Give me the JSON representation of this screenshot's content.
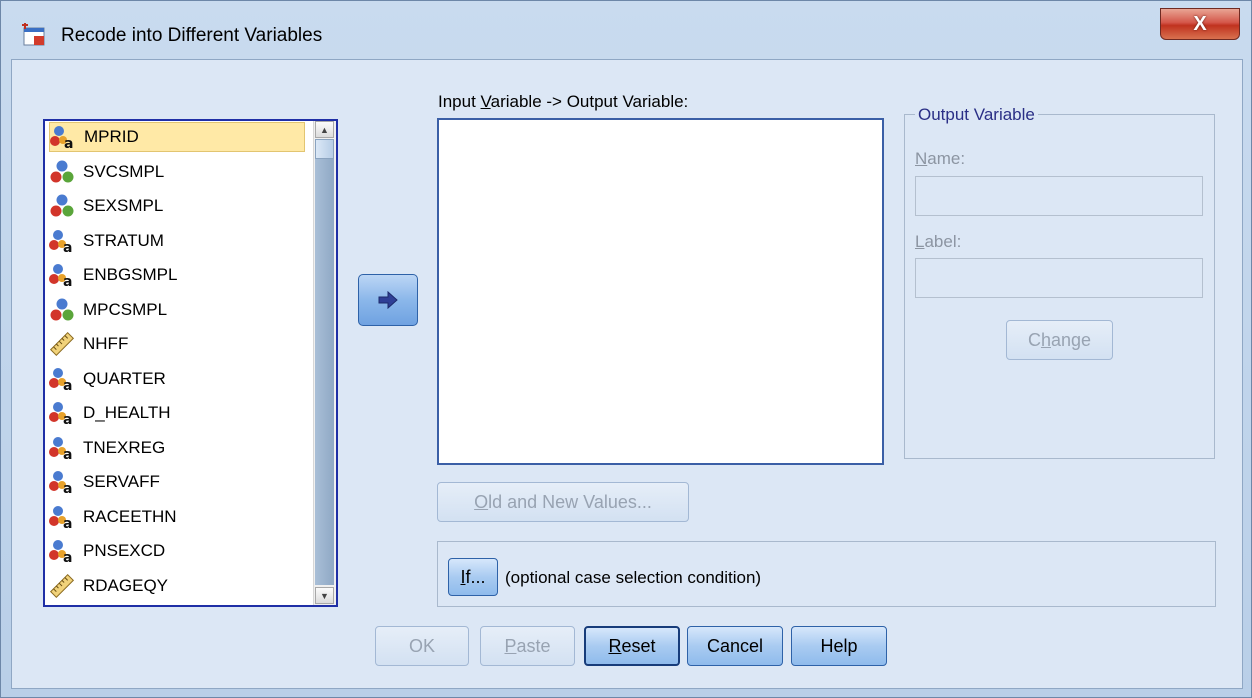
{
  "window": {
    "title": "Recode into Different Variables",
    "close_label": "X"
  },
  "variables": [
    {
      "name": "MPRID",
      "type": "nominal-string",
      "selected": true
    },
    {
      "name": "SVCSMPL",
      "type": "nominal"
    },
    {
      "name": "SEXSMPL",
      "type": "nominal"
    },
    {
      "name": "STRATUM",
      "type": "nominal-string"
    },
    {
      "name": "ENBGSMPL",
      "type": "nominal-string"
    },
    {
      "name": "MPCSMPL",
      "type": "nominal"
    },
    {
      "name": "NHFF",
      "type": "scale"
    },
    {
      "name": "QUARTER",
      "type": "nominal-string"
    },
    {
      "name": "D_HEALTH",
      "type": "nominal-string"
    },
    {
      "name": "TNEXREG",
      "type": "nominal-string"
    },
    {
      "name": "SERVAFF",
      "type": "nominal-string"
    },
    {
      "name": "RACEETHN",
      "type": "nominal-string"
    },
    {
      "name": "PNSEXCD",
      "type": "nominal-string"
    },
    {
      "name": "RDAGEQY",
      "type": "scale"
    }
  ],
  "mapping": {
    "label_pre": "Input ",
    "label_underlined": "V",
    "label_post": "ariable -> Output Variable:"
  },
  "output_variable": {
    "group_title": "Output Variable",
    "name_label_u": "N",
    "name_label_rest": "ame:",
    "name_value": "",
    "label_label_u": "L",
    "label_label_rest": "abel:",
    "label_value": "",
    "change_pre": "C",
    "change_u": "h",
    "change_post": "ange"
  },
  "old_new": {
    "u": "O",
    "rest": "ld and New Values..."
  },
  "if_panel": {
    "button_u": "I",
    "button_rest": "f...",
    "description": "(optional case selection condition)"
  },
  "footer": {
    "ok": "OK",
    "paste_u": "P",
    "paste_rest": "aste",
    "reset_u": "R",
    "reset_rest": "eset",
    "cancel": "Cancel",
    "help": "Help"
  },
  "colors": {
    "selection": "#ffe9a6",
    "close_button": "#c0321f",
    "button_blue": "#8fbbec"
  }
}
